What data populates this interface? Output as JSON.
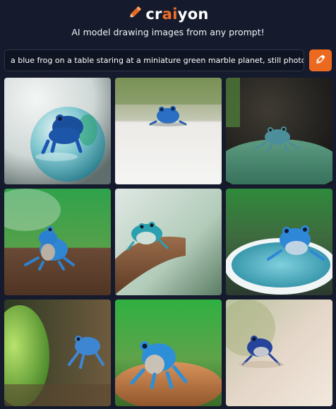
{
  "brand": {
    "logo_prefix": "cr",
    "logo_accent": "ai",
    "logo_suffix": "yon",
    "tagline": "AI model drawing images from any prompt!",
    "accent_color": "#ec6a1f",
    "logo_icon": "pencil-icon"
  },
  "prompt": {
    "value": "a blue frog on a table staring at a miniature green marble planet, still photography",
    "button_icon": "pencil-icon"
  },
  "results": {
    "images": [
      {
        "subject": "blue frog inside glass marble"
      },
      {
        "subject": "small blue frog on white table"
      },
      {
        "subject": "frog on green round surface, dark background"
      },
      {
        "subject": "blue frog on wooden table, green background"
      },
      {
        "subject": "frog on wooden plank"
      },
      {
        "subject": "blue frog on teal plate"
      },
      {
        "subject": "frog beside green pebble"
      },
      {
        "subject": "blue frog on wooden stump"
      },
      {
        "subject": "small dark blue frog, blurry background"
      }
    ]
  }
}
